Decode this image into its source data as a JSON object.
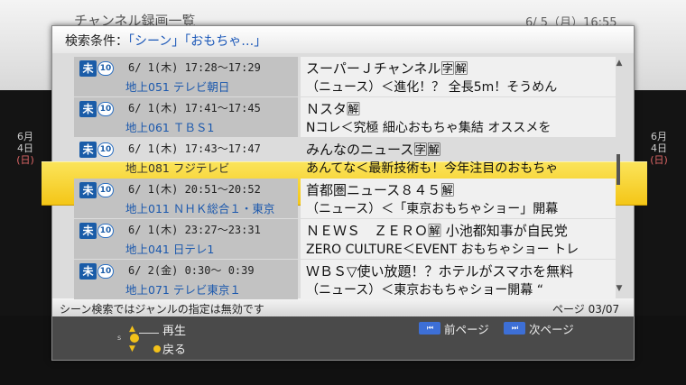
{
  "background": {
    "title": "チャンネル録画一覧",
    "datetime": "6/ 5（月）16:55",
    "date_left": {
      "month": "6月",
      "day": "4日",
      "weekday": "(日)"
    },
    "date_right": {
      "month": "6月",
      "day": "4日",
      "weekday": "(日)"
    }
  },
  "dialog": {
    "header_label": "検索条件：",
    "header_value": "「シーン」「おもちゃ…」",
    "rows": [
      {
        "badge": "未",
        "badge_num": "10",
        "time": "6/ 1(木) 17:28～17:29",
        "channel": "地上051 テレビ朝日",
        "title": "スーパーＪチャンネル🈑🈖",
        "desc": "（ニュース）＜進化！？ 全長5m！そうめん"
      },
      {
        "badge": "未",
        "badge_num": "10",
        "time": "6/ 1(木) 17:41～17:45",
        "channel": "地上061 ＴＢＳ1",
        "title": "Ｎスタ🈖",
        "desc": "Nコレ＜究極 細心おもちゃ集結 オススメを"
      },
      {
        "badge": "未",
        "badge_num": "10",
        "time": "6/ 1(木) 17:43～17:47",
        "channel": "地上081 フジテレビ",
        "title": "みんなのニュース🈑🈖",
        "desc": "あんてな＜最新技術も！今年注目のおもちゃ",
        "selected": true
      },
      {
        "badge": "未",
        "badge_num": "10",
        "time": "6/ 1(木) 20:51～20:52",
        "channel": "地上011 ＮＨＫ総合１・東京",
        "title": "首都圏ニュース８４５🈖",
        "desc": "（ニュース）＜「東京おもちゃショー」開幕"
      },
      {
        "badge": "未",
        "badge_num": "10",
        "time": "6/ 1(木) 23:27～23:31",
        "channel": "地上041 日テレ1",
        "title": "ＮＥＷＳ　ＺＥＲＯ🈖 小池都知事が自民党",
        "desc": "ZERO CULTURE＜EVENT おもちゃショー トレ"
      },
      {
        "badge": "未",
        "badge_num": "10",
        "time": "6/ 2(金)  0:30～ 0:39",
        "channel": "地上071 テレビ東京１",
        "title": "ＷＢＳ▽使い放題！？ホテルがスマホを無料",
        "desc": "（ニュース）＜東京おもちゃショー開幕 “"
      }
    ],
    "info_note": "シーン検索ではジャンルの指定は無効です",
    "page_indicator": "ページ 03/07",
    "footer": {
      "play_label": "再生",
      "back_label": "戻る",
      "prev_btn_icon": "⏮",
      "prev_label": "前ページ",
      "next_btn_icon": "⏭",
      "next_label": "次ページ",
      "nav_up": "▲",
      "nav_down": "▼",
      "nav_left": "s"
    }
  },
  "colors": {
    "highlight": "#f4c617",
    "accent_blue": "#1a5ca8",
    "page_button": "#3d6fd6"
  }
}
